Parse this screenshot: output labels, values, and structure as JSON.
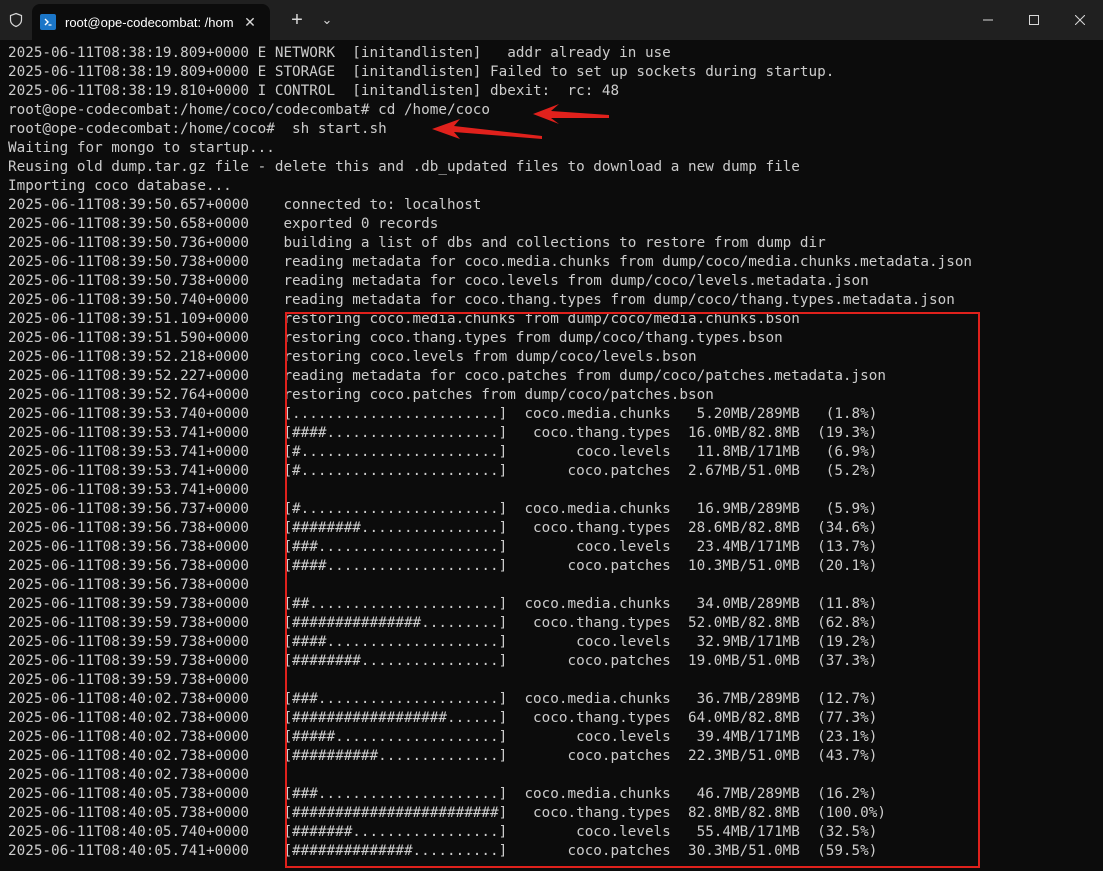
{
  "window": {
    "tab_title": "root@ope-codecombat: /hom",
    "tab_close": "✕",
    "new_tab": "+",
    "dropdown": "⌄"
  },
  "terminal": {
    "lines": [
      "2025-06-11T08:38:19.809+0000 E NETWORK  [initandlisten]   addr already in use",
      "2025-06-11T08:38:19.809+0000 E STORAGE  [initandlisten] Failed to set up sockets during startup.",
      "2025-06-11T08:38:19.810+0000 I CONTROL  [initandlisten] dbexit:  rc: 48",
      "root@ope-codecombat:/home/coco/codecombat# cd /home/coco",
      "root@ope-codecombat:/home/coco#  sh start.sh",
      "Waiting for mongo to startup...",
      "Reusing old dump.tar.gz file - delete this and .db_updated files to download a new dump file",
      "Importing coco database...",
      "2025-06-11T08:39:50.657+0000    connected to: localhost",
      "2025-06-11T08:39:50.658+0000    exported 0 records",
      "2025-06-11T08:39:50.736+0000    building a list of dbs and collections to restore from dump dir",
      "2025-06-11T08:39:50.738+0000    reading metadata for coco.media.chunks from dump/coco/media.chunks.metadata.json",
      "2025-06-11T08:39:50.738+0000    reading metadata for coco.levels from dump/coco/levels.metadata.json",
      "2025-06-11T08:39:50.740+0000    reading metadata for coco.thang.types from dump/coco/thang.types.metadata.json",
      "2025-06-11T08:39:51.109+0000    restoring coco.media.chunks from dump/coco/media.chunks.bson",
      "2025-06-11T08:39:51.590+0000    restoring coco.thang.types from dump/coco/thang.types.bson",
      "2025-06-11T08:39:52.218+0000    restoring coco.levels from dump/coco/levels.bson",
      "2025-06-11T08:39:52.227+0000    reading metadata for coco.patches from dump/coco/patches.metadata.json",
      "2025-06-11T08:39:52.764+0000    restoring coco.patches from dump/coco/patches.bson",
      "2025-06-11T08:39:53.740+0000    [........................]  coco.media.chunks   5.20MB/289MB   (1.8%)",
      "2025-06-11T08:39:53.741+0000    [####....................]   coco.thang.types  16.0MB/82.8MB  (19.3%)",
      "2025-06-11T08:39:53.741+0000    [#.......................]        coco.levels   11.8MB/171MB   (6.9%)",
      "2025-06-11T08:39:53.741+0000    [#.......................]       coco.patches  2.67MB/51.0MB   (5.2%)",
      "2025-06-11T08:39:53.741+0000",
      "2025-06-11T08:39:56.737+0000    [#.......................]  coco.media.chunks   16.9MB/289MB   (5.9%)",
      "2025-06-11T08:39:56.738+0000    [########................]   coco.thang.types  28.6MB/82.8MB  (34.6%)",
      "2025-06-11T08:39:56.738+0000    [###.....................]        coco.levels   23.4MB/171MB  (13.7%)",
      "2025-06-11T08:39:56.738+0000    [####....................]       coco.patches  10.3MB/51.0MB  (20.1%)",
      "2025-06-11T08:39:56.738+0000",
      "2025-06-11T08:39:59.738+0000    [##......................]  coco.media.chunks   34.0MB/289MB  (11.8%)",
      "2025-06-11T08:39:59.738+0000    [###############.........]   coco.thang.types  52.0MB/82.8MB  (62.8%)",
      "2025-06-11T08:39:59.738+0000    [####....................]        coco.levels   32.9MB/171MB  (19.2%)",
      "2025-06-11T08:39:59.738+0000    [########................]       coco.patches  19.0MB/51.0MB  (37.3%)",
      "2025-06-11T08:39:59.738+0000",
      "2025-06-11T08:40:02.738+0000    [###.....................]  coco.media.chunks   36.7MB/289MB  (12.7%)",
      "2025-06-11T08:40:02.738+0000    [##################......]   coco.thang.types  64.0MB/82.8MB  (77.3%)",
      "2025-06-11T08:40:02.738+0000    [#####...................]        coco.levels   39.4MB/171MB  (23.1%)",
      "2025-06-11T08:40:02.738+0000    [##########..............]       coco.patches  22.3MB/51.0MB  (43.7%)",
      "2025-06-11T08:40:02.738+0000",
      "2025-06-11T08:40:05.738+0000    [###.....................]  coco.media.chunks   46.7MB/289MB  (16.2%)",
      "2025-06-11T08:40:05.738+0000    [########################]   coco.thang.types  82.8MB/82.8MB  (100.0%)",
      "2025-06-11T08:40:05.740+0000    [#######.................]        coco.levels   55.4MB/171MB  (32.5%)",
      "2025-06-11T08:40:05.741+0000    [##############..........]       coco.patches  30.3MB/51.0MB  (59.5%)"
    ]
  },
  "colors": {
    "background": "#0c0c0c",
    "text": "#cccccc",
    "annotation": "#e0211c",
    "tab_icon": "#1b76c8"
  }
}
